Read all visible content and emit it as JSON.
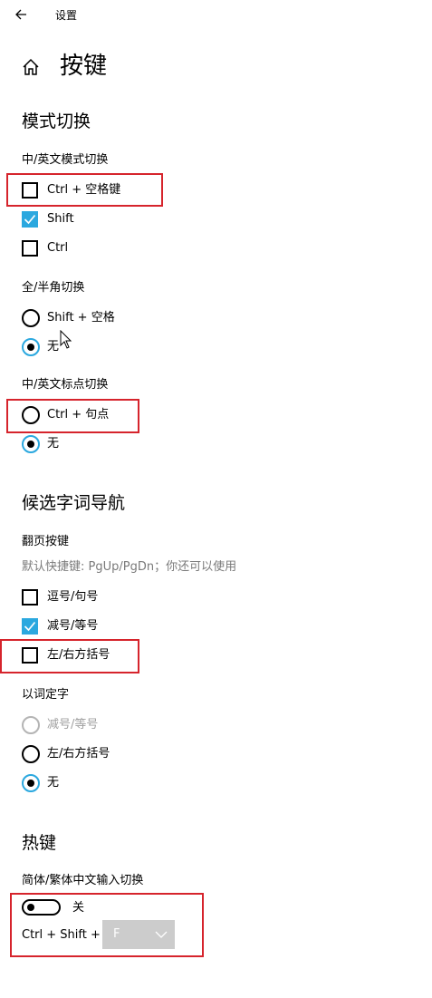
{
  "titlebar": {
    "title": "设置"
  },
  "page": {
    "title": "按键"
  },
  "sections": {
    "mode_switch": {
      "title": "模式切换",
      "cn_en_mode": {
        "label": "中/英文模式切换",
        "options": [
          {
            "label": "Ctrl + 空格键",
            "checked": false
          },
          {
            "label": "Shift",
            "checked": true
          },
          {
            "label": "Ctrl",
            "checked": false
          }
        ]
      },
      "full_half": {
        "label": "全/半角切换",
        "options": [
          {
            "label": "Shift + 空格",
            "selected": false
          },
          {
            "label": "无",
            "selected": true
          }
        ]
      },
      "punct": {
        "label": "中/英文标点切换",
        "options": [
          {
            "label": "Ctrl + 句点",
            "selected": false
          },
          {
            "label": "无",
            "selected": true
          }
        ]
      }
    },
    "candidate_nav": {
      "title": "候选字词导航",
      "paging": {
        "label": "翻页按键",
        "description": "默认快捷键: PgUp/PgDn；你还可以使用",
        "options": [
          {
            "label": "逗号/句号",
            "checked": false
          },
          {
            "label": "减号/等号",
            "checked": true
          },
          {
            "label": "左/右方括号",
            "checked": false
          }
        ]
      },
      "word_to_char": {
        "label": "以词定字",
        "options": [
          {
            "label": "减号/等号",
            "selected": false,
            "disabled": true
          },
          {
            "label": "左/右方括号",
            "selected": false
          },
          {
            "label": "无",
            "selected": true
          }
        ]
      }
    },
    "hotkeys": {
      "title": "热键",
      "simp_trad": {
        "label": "简体/繁体中文输入切换",
        "toggle_state": "关",
        "toggle_on": false,
        "shortcut_prefix": "Ctrl + Shift +",
        "shortcut_key": "F"
      }
    }
  },
  "colors": {
    "accent": "#2ba8df",
    "highlight": "#d6242c",
    "disabled": "#a0a0a0"
  },
  "icons": [
    "back-arrow-icon",
    "home-icon",
    "checkmark-icon",
    "chevron-down-icon",
    "mouse-cursor-icon"
  ]
}
